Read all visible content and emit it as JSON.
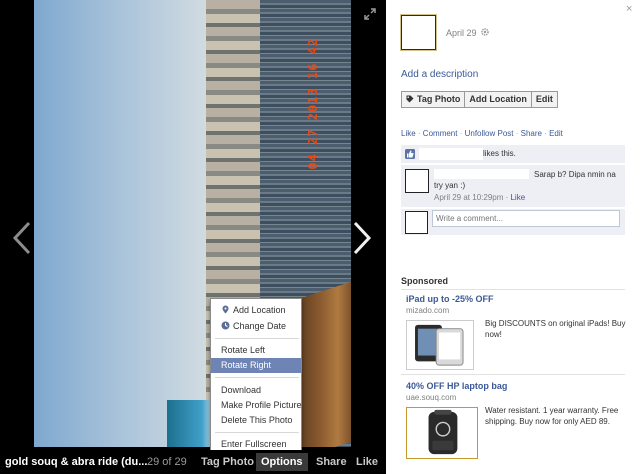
{
  "viewer": {
    "photo_datestamp": "04 27 2013 16 42",
    "bottom_bar": {
      "title": "gold souq & abra ride (du...",
      "counter": "29 of 29",
      "tag_photo": "Tag Photo",
      "options": "Options",
      "share": "Share",
      "like": "Like"
    },
    "options_menu": {
      "items": [
        {
          "label": "Add Location",
          "icon": "location-pin-icon"
        },
        {
          "label": "Change Date",
          "icon": "clock-icon"
        },
        {
          "label": "Rotate Left"
        },
        {
          "label": "Rotate Right",
          "highlighted": true
        },
        {
          "label": "Download"
        },
        {
          "label": "Make Profile Picture"
        },
        {
          "label": "Delete This Photo"
        },
        {
          "label": "Enter Fullscreen"
        }
      ]
    }
  },
  "panel": {
    "close": "×",
    "post_date": "April 29",
    "add_description": "Add a description",
    "actions": {
      "tag_photo": "Tag Photo",
      "add_location": "Add Location",
      "edit": "Edit"
    },
    "links": {
      "like": "Like",
      "comment": "Comment",
      "unfollow": "Unfollow Post",
      "share": "Share",
      "edit": "Edit",
      "separator": " · "
    },
    "likes_text": "likes this.",
    "comment": {
      "text": "Sarap b? Dipa nmin na try yan :)",
      "time": "April 29 at 10:29pm",
      "like": "Like",
      "separator": " · "
    },
    "write_comment_placeholder": "Write a comment...",
    "sponsored": {
      "header": "Sponsored",
      "ads": [
        {
          "title": "iPad up to -25% OFF",
          "domain": "mizado.com",
          "body": "Big DISCOUNTS on original iPads! Buy now!"
        },
        {
          "title": "40% OFF HP laptop bag",
          "domain": "uae.souq.com",
          "body": "Water resistant. 1 year warranty. Free shipping. Buy now for only AED 89."
        }
      ]
    }
  },
  "colors": {
    "link_blue": "#3b5998",
    "menu_highlight": "#6d84b4",
    "panel_gray": "#edeff4",
    "datestamp_orange": "#e44a16"
  }
}
